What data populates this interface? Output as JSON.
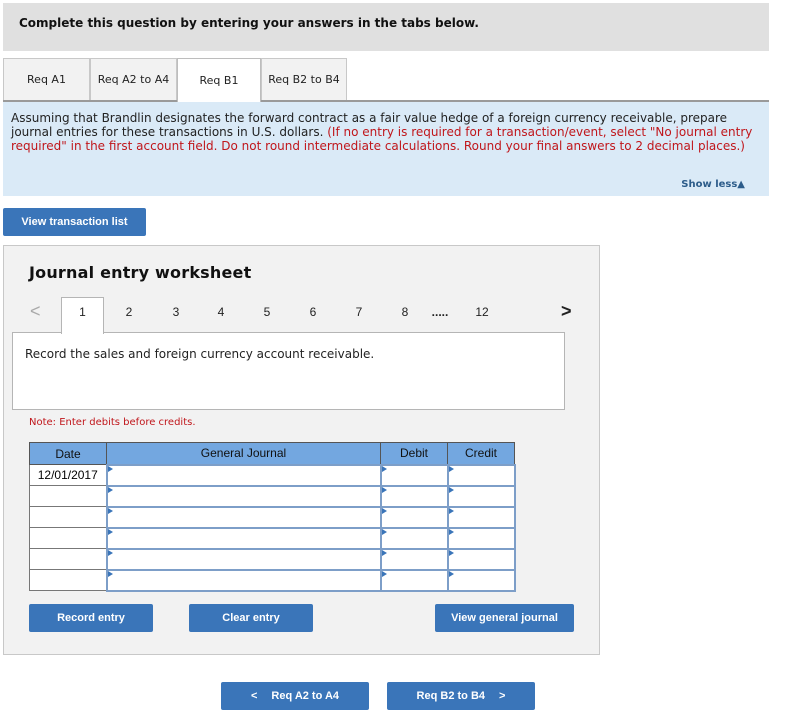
{
  "header": {
    "title": "Complete this question by entering your answers in the tabs below."
  },
  "tabs": [
    {
      "label": "Req A1",
      "active": false
    },
    {
      "label": "Req A2 to A4",
      "active": false
    },
    {
      "label": "Req B1",
      "active": true
    },
    {
      "label": "Req B2 to B4",
      "active": false
    }
  ],
  "instructions": {
    "text": "Assuming that Brandlin designates the forward contract as a fair value hedge of a foreign currency receivable, prepare journal entries for these transactions in U.S. dollars. ",
    "red_text": "(If no entry is required for a transaction/event, select \"No journal entry required\" in the first account field. Do not round intermediate calculations. Round your final answers to 2 decimal places.)",
    "show_less": "Show less▲"
  },
  "view_transaction_list": "View transaction list",
  "worksheet": {
    "title": "Journal entry worksheet",
    "pages": [
      "1",
      "2",
      "3",
      "4",
      "5",
      "6",
      "7",
      "8",
      ".....",
      "12"
    ],
    "active_page": "1",
    "prev_arrow": "<",
    "next_arrow": ">",
    "description": "Record the sales and foreign currency account receivable.",
    "note": "Note: Enter debits before credits.",
    "columns": [
      "Date",
      "General Journal",
      "Debit",
      "Credit"
    ],
    "rows": [
      {
        "date": "12/01/2017",
        "account": "",
        "debit": "",
        "credit": ""
      },
      {
        "date": "",
        "account": "",
        "debit": "",
        "credit": ""
      },
      {
        "date": "",
        "account": "",
        "debit": "",
        "credit": ""
      },
      {
        "date": "",
        "account": "",
        "debit": "",
        "credit": ""
      },
      {
        "date": "",
        "account": "",
        "debit": "",
        "credit": ""
      },
      {
        "date": "",
        "account": "",
        "debit": "",
        "credit": ""
      }
    ],
    "record_entry": "Record entry",
    "clear_entry": "Clear entry",
    "view_general_journal": "View general journal"
  },
  "nav": {
    "prev_label": "Req A2 to A4",
    "next_label": "Req B2 to B4",
    "prev_icon": "<",
    "next_icon": ">"
  }
}
